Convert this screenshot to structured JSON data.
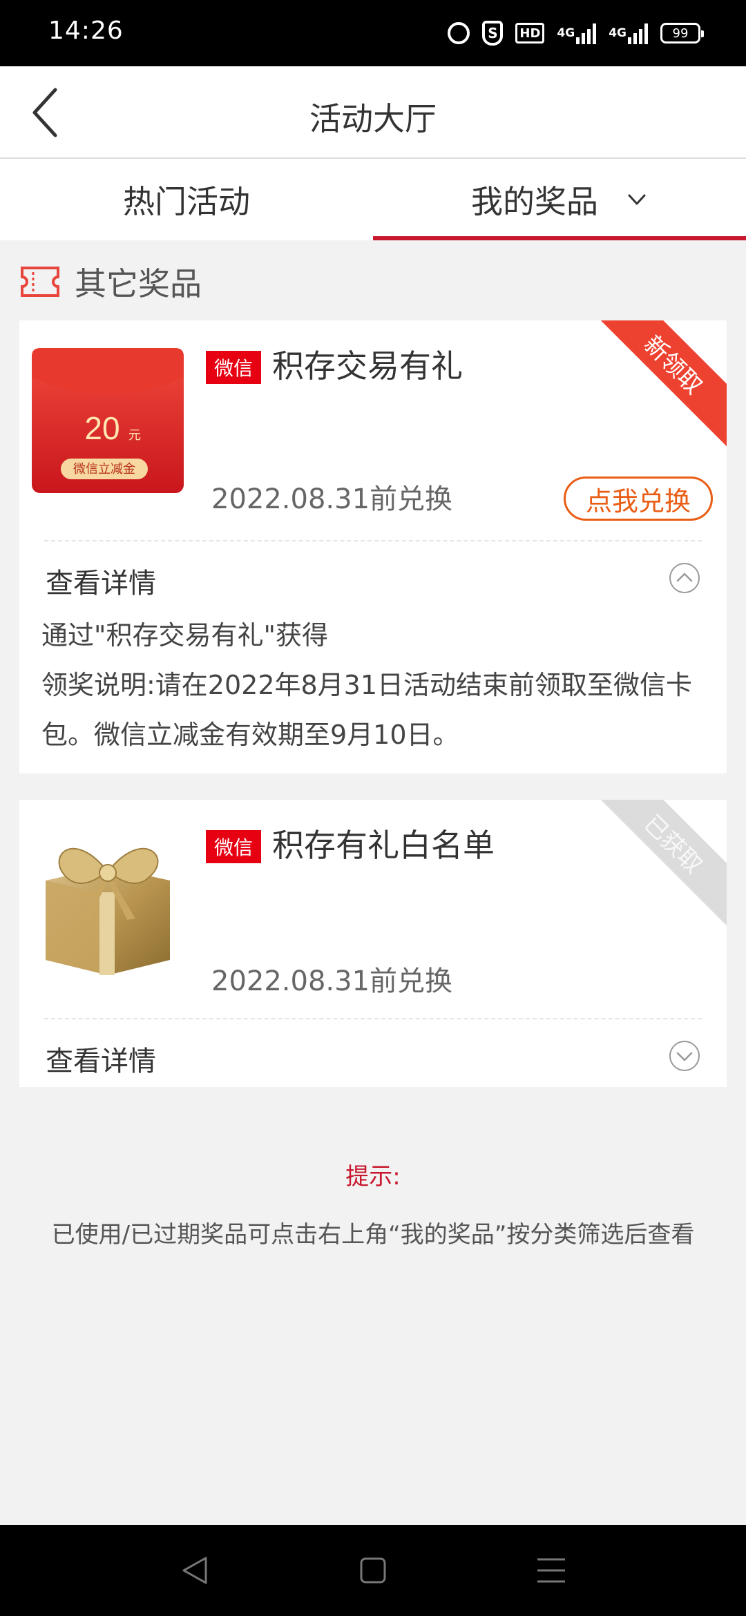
{
  "status_bar": {
    "time": "14:26",
    "hd": "HD",
    "net1": "4G",
    "net2": "4G",
    "battery": "99"
  },
  "header": {
    "title": "活动大厅"
  },
  "tabs": [
    {
      "label": "热门活动",
      "active": false
    },
    {
      "label": "我的奖品",
      "active": true
    }
  ],
  "section": {
    "title": "其它奖品"
  },
  "prizes": [
    {
      "brand": "微信",
      "name": "积存交易有礼",
      "expiry": "2022.08.31前兑换",
      "ribbon": "新领取",
      "redeem_label": "点我兑换",
      "image": {
        "amount": "20",
        "unit": "元",
        "label": "微信立减金"
      },
      "details_label": "查看详情",
      "details_lines": [
        "通过\"积存交易有礼\"获得",
        "领奖说明:请在2022年8月31日活动结束前领取至微信卡包。微信立减金有效期至9月10日。"
      ]
    },
    {
      "brand": "微信",
      "name": "积存有礼白名单",
      "expiry": "2022.08.31前兑换",
      "ribbon": "已获取",
      "details_label": "查看详情"
    }
  ],
  "tip": {
    "title": "提示:",
    "text": "已使用/已过期奖品可点击右上角“我的奖品”按分类筛选后查看"
  },
  "colors": {
    "brand_red": "#c8182d",
    "tag_red": "#e60012",
    "orange": "#e95d14"
  }
}
